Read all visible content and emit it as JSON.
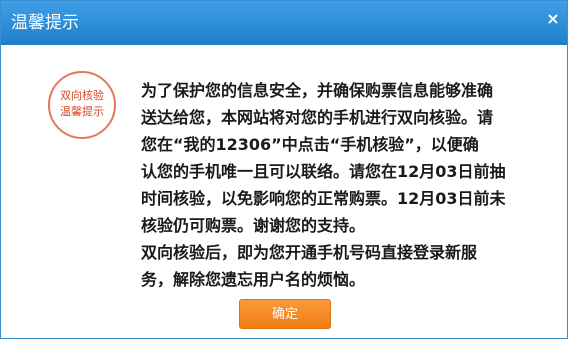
{
  "dialog": {
    "title": "温馨提示",
    "close_label": "×"
  },
  "stamp": {
    "line1": "双向核验",
    "line2": "温馨提示"
  },
  "message": {
    "lines": [
      "为了保护您的信息安全，并确保购票信息能够准确",
      "送达给您，本网站将对您的手机进行双向核验。请",
      "您在“我的12306”中点击“手机核验”，以便确",
      "认您的手机唯一且可以联络。请您在12月03日前抽",
      "时间核验，以免影响您的正常购票。12月03日前未",
      "核验仍可购票。谢谢您的支持。",
      "双向核验后，即为您开通手机号码直接登录新服",
      "务，解除您遗忘用户名的烦恼。"
    ]
  },
  "buttons": {
    "confirm_label": "确定"
  },
  "colors": {
    "titlebar": "#2b8ad6",
    "confirm": "#f5891f",
    "stamp": "#d94b2a"
  }
}
